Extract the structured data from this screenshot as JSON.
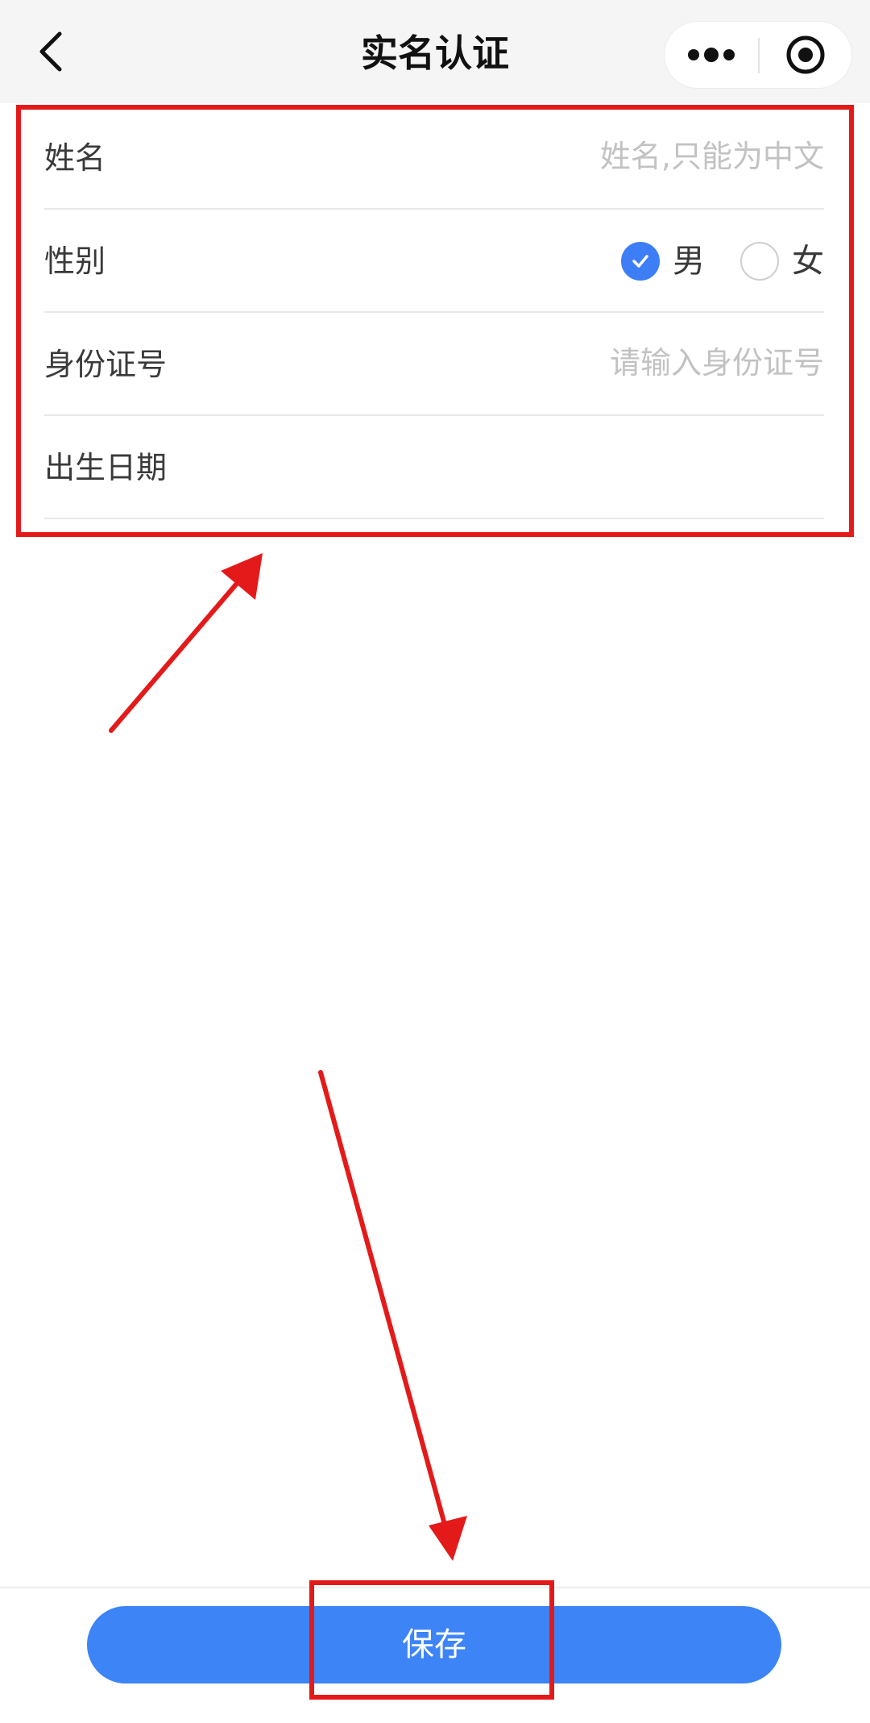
{
  "navbar": {
    "title": "实名认证",
    "back_icon": "chevron-left-icon",
    "more_icon": "more-dots-icon",
    "close_icon": "target-circle-icon"
  },
  "form": {
    "name": {
      "label": "姓名",
      "placeholder": "姓名,只能为中文",
      "value": ""
    },
    "gender": {
      "label": "性别",
      "options": [
        {
          "label": "男",
          "checked": true
        },
        {
          "label": "女",
          "checked": false
        }
      ]
    },
    "id_number": {
      "label": "身份证号",
      "placeholder": "请输入身份证号",
      "value": ""
    },
    "birth_date": {
      "label": "出生日期",
      "value": ""
    }
  },
  "footer": {
    "save_label": "保存"
  },
  "colors": {
    "accent": "#3d84f7",
    "annotation": "#e41a1a"
  }
}
